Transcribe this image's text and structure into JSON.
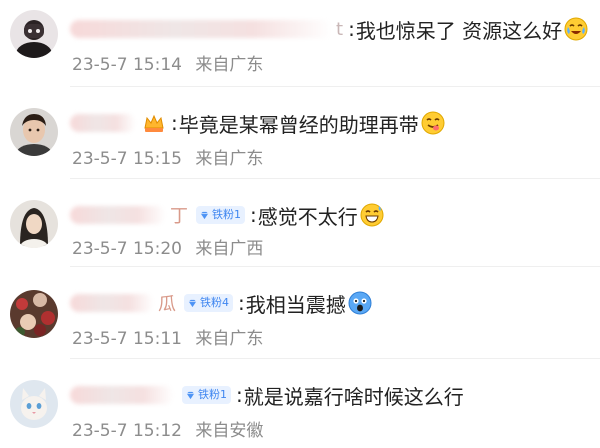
{
  "comments": [
    {
      "badge": "",
      "name_tail": "t",
      "text": "我也惊呆了 资源这么好",
      "emoji": "tears-of-joy-emoji",
      "date": "23-5-7",
      "time": "15:14",
      "location": "来自广东"
    },
    {
      "badge": "",
      "name_tail": "",
      "text": "毕竟是某幂曾经的助理再带",
      "emoji": "yum-emoji",
      "date": "23-5-7",
      "time": "15:15",
      "location": "来自广东"
    },
    {
      "badge": "铁粉1",
      "name_tail": "丁",
      "text": "感觉不太行",
      "emoji": "grin-sweat-emoji",
      "date": "23-5-7",
      "time": "15:20",
      "location": "来自广西"
    },
    {
      "badge": "铁粉4",
      "name_tail": "瓜",
      "text": "我相当震撼",
      "emoji": "shocked-emoji",
      "date": "23-5-7",
      "time": "15:11",
      "location": "来自广东"
    },
    {
      "badge": "铁粉1",
      "name_tail": "",
      "text": "就是说嘉行啥时候这么行",
      "emoji": "",
      "date": "23-5-7",
      "time": "15:12",
      "location": "来自安徽"
    }
  ],
  "colors": {
    "badge_bg": "#e8f1ff",
    "badge_text": "#3f86f0",
    "meta_text": "#8c8c8c",
    "body_text": "#222222"
  }
}
